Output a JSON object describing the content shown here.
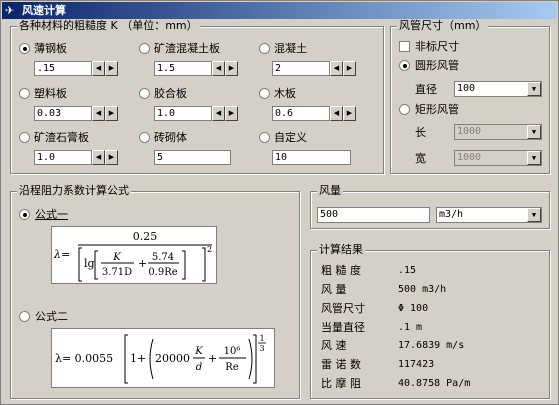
{
  "window": {
    "title": "风速计算"
  },
  "roughness": {
    "legend": "各种材料的粗糙度 K （单位：mm）",
    "items": [
      {
        "label": "薄钢板",
        "value": ".15",
        "selected": true
      },
      {
        "label": "矿渣混凝土板",
        "value": "1.5"
      },
      {
        "label": "混凝土",
        "value": "2"
      },
      {
        "label": "塑料板",
        "value": "0.03"
      },
      {
        "label": "胶合板",
        "value": "1.0"
      },
      {
        "label": "木板",
        "value": "0.6"
      },
      {
        "label": "矿渣石膏板",
        "value": "1.0"
      },
      {
        "label": "砖砌体",
        "value": "5"
      },
      {
        "label": "自定义",
        "value": "10"
      }
    ]
  },
  "duct": {
    "legend": "风管尺寸（mm）",
    "nonstandard": "非标尺寸",
    "round": "圆形风管",
    "diameter_label": "直径",
    "diameter_value": "100",
    "rect": "矩形风管",
    "length_label": "长",
    "length_value": "1000",
    "width_label": "宽",
    "width_value": "1000"
  },
  "formula": {
    "legend": "沿程阻力系数计算公式",
    "f1_label": "公式一",
    "f2_label": "公式二",
    "f1": {
      "lambda": "λ=",
      "num": "0.25",
      "lg": "lg",
      "K": "K",
      "den1": "3.71D",
      "plus": "+",
      "n2": "5.74",
      "d2": "0.9Re",
      "sq": "2"
    },
    "f2": {
      "lhs": "λ= 0.0055",
      "one": "1+",
      "c": "20000",
      "K": "K",
      "d": "d",
      "plus": "+",
      "e6": "10⁶",
      "Re": "Re",
      "exp_n": "1",
      "exp_d": "3"
    }
  },
  "flow": {
    "legend": "风量",
    "value": "500",
    "unit": "m3/h"
  },
  "results": {
    "legend": "计算结果",
    "rows": [
      {
        "label": "粗 糙 度",
        "value": ".15"
      },
      {
        "label": "风    量",
        "value": "500 m3/h"
      },
      {
        "label": "风管尺寸",
        "value": "Φ 100"
      },
      {
        "label": "当量直径",
        "value": ".1 m"
      },
      {
        "label": "风    速",
        "value": "17.6839 m/s"
      },
      {
        "label": "雷 诺 数",
        "value": "117423"
      },
      {
        "label": "比 摩 阻",
        "value": "40.8758 Pa/m"
      }
    ]
  }
}
